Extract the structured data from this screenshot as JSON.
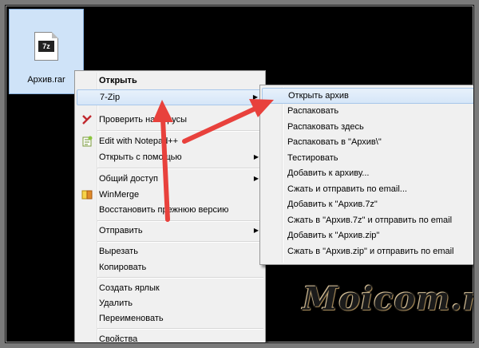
{
  "desktop": {
    "file_name": "Архив.rar",
    "file_icon_label": "7z"
  },
  "context_menu": {
    "items": [
      {
        "label": "Открыть",
        "bold": true
      },
      {
        "label": "7-Zip",
        "submenu": true,
        "highlighted": true
      },
      {
        "label": "Проверить на вирусы",
        "icon": "kaspersky-icon"
      },
      {
        "label": "Edit with Notepad++",
        "icon": "notepad-plus-plus-icon"
      },
      {
        "label": "Открыть с помощью",
        "submenu": true
      },
      {
        "label": "Общий доступ",
        "submenu": true
      },
      {
        "label": "WinMerge",
        "icon": "winmerge-icon"
      },
      {
        "label": "Восстановить прежнюю версию"
      },
      {
        "label": "Отправить",
        "submenu": true
      },
      {
        "label": "Вырезать"
      },
      {
        "label": "Копировать"
      },
      {
        "label": "Создать ярлык"
      },
      {
        "label": "Удалить"
      },
      {
        "label": "Переименовать"
      },
      {
        "label": "Свойства"
      }
    ]
  },
  "submenu_7zip": {
    "items": [
      {
        "label": "Открыть архив",
        "highlighted": true
      },
      {
        "label": "Распаковать"
      },
      {
        "label": "Распаковать здесь"
      },
      {
        "label": "Распаковать в \"Архив\\\""
      },
      {
        "label": "Тестировать"
      },
      {
        "label": "Добавить к архиву..."
      },
      {
        "label": "Сжать и отправить по email..."
      },
      {
        "label": "Добавить к \"Архив.7z\""
      },
      {
        "label": "Сжать в \"Архив.7z\" и отправить по email"
      },
      {
        "label": "Добавить к \"Архив.zip\""
      },
      {
        "label": "Сжать в \"Архив.zip\" и отправить по email"
      }
    ]
  },
  "logo": {
    "text": "Moicom.ru"
  },
  "colors": {
    "arrow": "#e8413c",
    "selection": "#cfe3f8",
    "menu_bg": "#f0f0f0"
  }
}
